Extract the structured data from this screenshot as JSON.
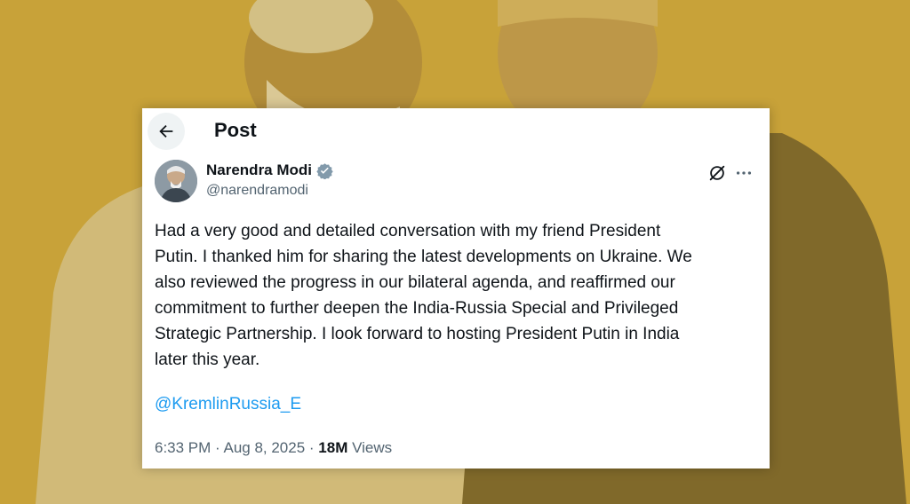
{
  "header": {
    "title": "Post",
    "back_icon": "arrow-left-icon"
  },
  "author": {
    "name": "Narendra Modi",
    "handle": "@narendramodi",
    "verified_icon": "verified-badge-icon",
    "verified_color": "#829aab"
  },
  "tweet": {
    "text": "Had a very good and detailed conversation with my friend President\nPutin. I thanked him for sharing the latest developments on Ukraine. We\nalso reviewed the progress in our bilateral agenda, and reaffirmed our\ncommitment to further deepen the India-Russia Special and Privileged\nStrategic Partnership. I look forward to hosting President Putin in India\nlater this year.",
    "mention": "@KremlinRussia_E",
    "time": "6:33 PM",
    "sep1": " · ",
    "date": "Aug 8, 2025",
    "sep2": " · ",
    "views_count": "18M",
    "views_label": " Views"
  },
  "actions": {
    "grok_icon": "grok-icon",
    "more_icon": "more-horizontal-icon"
  },
  "colors": {
    "background_tint": "#c9a43a",
    "link": "#1d9bf0",
    "text": "#0f1419",
    "muted": "#536471"
  }
}
